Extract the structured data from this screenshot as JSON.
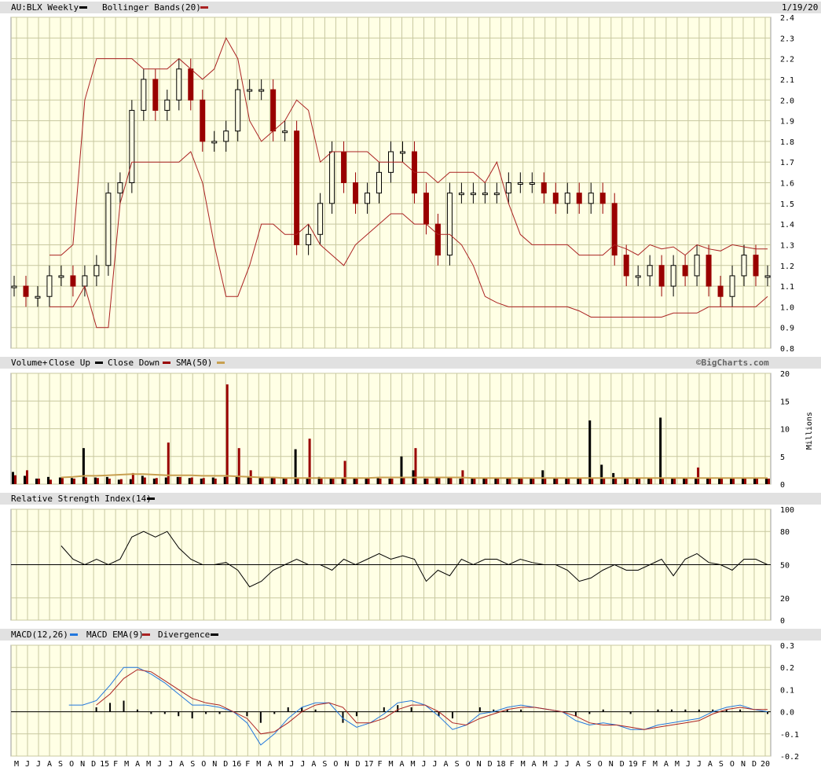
{
  "price_header": {
    "symbol_label": "AU:BLX Weekly",
    "bb_label": "Bollinger Bands(20)",
    "date": "1/19/20"
  },
  "volume_header": {
    "label": "Volume+",
    "close_up": "Close Up",
    "close_down": "Close Down",
    "sma": "SMA(50)",
    "credit": "©BigCharts.com"
  },
  "rsi_header": {
    "label": "Relative Strength Index(14)"
  },
  "macd_header": {
    "label": "MACD(12,26)",
    "ema": "MACD EMA(9)",
    "divergence": "Divergence"
  },
  "colors": {
    "panel_bg": "#ffffe5",
    "grid": "#c8c8a0",
    "up": "#000000",
    "down": "#990000",
    "band": "#aa2222",
    "sma": "#c8a050",
    "macd": "#2277dd",
    "macd_ema": "#aa2222"
  },
  "x_axis_labels": [
    "M",
    "J",
    "J",
    "A",
    "S",
    "O",
    "N",
    "D",
    "15",
    "F",
    "M",
    "A",
    "M",
    "J",
    "J",
    "A",
    "S",
    "O",
    "N",
    "D",
    "16",
    "F",
    "M",
    "A",
    "M",
    "J",
    "J",
    "A",
    "S",
    "O",
    "N",
    "D",
    "17",
    "F",
    "M",
    "A",
    "M",
    "J",
    "J",
    "A",
    "S",
    "O",
    "N",
    "D",
    "18",
    "F",
    "M",
    "A",
    "M",
    "J",
    "J",
    "A",
    "S",
    "O",
    "N",
    "D",
    "19",
    "F",
    "M",
    "A",
    "M",
    "J",
    "J",
    "A",
    "S",
    "O",
    "N",
    "D",
    "20"
  ],
  "chart_data": [
    {
      "type": "candlestick",
      "title": "AU:BLX Weekly",
      "ylim": [
        0.8,
        2.4
      ],
      "yticks": [
        0.8,
        0.9,
        1.0,
        1.1,
        1.2,
        1.3,
        1.4,
        1.5,
        1.6,
        1.7,
        1.8,
        1.9,
        2.0,
        2.1,
        2.2,
        2.3,
        2.4
      ],
      "x_range": [
        "2014-05",
        "2020-01"
      ],
      "close": [
        1.1,
        1.05,
        1.05,
        1.15,
        1.15,
        1.1,
        1.15,
        1.2,
        1.55,
        1.6,
        1.95,
        2.1,
        1.95,
        2.0,
        2.15,
        2.0,
        1.8,
        1.8,
        1.85,
        2.05,
        2.05,
        2.05,
        1.85,
        1.85,
        1.3,
        1.35,
        1.5,
        1.75,
        1.6,
        1.5,
        1.55,
        1.65,
        1.75,
        1.75,
        1.55,
        1.4,
        1.25,
        1.55,
        1.55,
        1.55,
        1.55,
        1.55,
        1.6,
        1.6,
        1.6,
        1.55,
        1.5,
        1.55,
        1.5,
        1.55,
        1.5,
        1.25,
        1.15,
        1.15,
        1.2,
        1.1,
        1.2,
        1.15,
        1.25,
        1.1,
        1.05,
        1.15,
        1.25,
        1.15,
        1.15
      ],
      "upper_band": [
        null,
        null,
        null,
        1.25,
        1.25,
        1.3,
        2.0,
        2.2,
        2.2,
        2.2,
        2.2,
        2.15,
        2.15,
        2.15,
        2.2,
        2.15,
        2.1,
        2.15,
        2.3,
        2.2,
        1.9,
        1.8,
        1.85,
        1.9,
        2.0,
        1.95,
        1.7,
        1.75,
        1.75,
        1.75,
        1.75,
        1.7,
        1.7,
        1.7,
        1.65,
        1.65,
        1.6,
        1.65,
        1.65,
        1.65,
        1.6,
        1.7,
        1.5,
        1.35,
        1.3,
        1.3,
        1.3,
        1.3,
        1.25,
        1.25,
        1.25,
        1.3,
        1.28,
        1.25,
        1.3,
        1.28,
        1.29,
        1.25,
        1.3,
        1.28,
        1.27,
        1.3,
        1.29,
        1.28,
        1.28
      ],
      "lower_band": [
        null,
        null,
        null,
        1.0,
        1.0,
        1.0,
        1.1,
        0.9,
        0.9,
        1.5,
        1.7,
        1.7,
        1.7,
        1.7,
        1.7,
        1.75,
        1.6,
        1.3,
        1.05,
        1.05,
        1.2,
        1.4,
        1.4,
        1.35,
        1.35,
        1.4,
        1.3,
        1.25,
        1.2,
        1.3,
        1.35,
        1.4,
        1.45,
        1.45,
        1.4,
        1.4,
        1.35,
        1.35,
        1.3,
        1.2,
        1.05,
        1.02,
        1.0,
        1.0,
        1.0,
        1.0,
        1.0,
        1.0,
        0.98,
        0.95,
        0.95,
        0.95,
        0.95,
        0.95,
        0.95,
        0.95,
        0.97,
        0.97,
        0.97,
        1.0,
        1.0,
        1.0,
        1.0,
        1.0,
        1.05
      ]
    },
    {
      "type": "bar",
      "title": "Volume+",
      "ylabel": "Millions",
      "ylim": [
        0,
        20
      ],
      "yticks": [
        0,
        5,
        10,
        15,
        20
      ],
      "series": [
        {
          "name": "Close Up",
          "values": [
            2.2,
            1.5,
            1.0,
            1.3,
            1.2,
            1.1,
            6.5,
            1.2,
            1.3,
            0.8,
            0.9,
            1.5,
            1.0,
            1.2,
            1.3,
            1.1,
            1.0,
            1.2,
            1.3,
            1.4,
            1.2,
            1.1,
            1.1,
            1.2,
            6.3,
            1.2,
            1.3,
            1.0,
            1.1,
            1.0,
            1.2,
            1.1,
            1.0,
            5.0,
            2.5,
            1.0,
            1.1,
            1.2,
            1.0,
            1.1,
            1.0,
            1.2,
            1.1,
            1.0,
            1.0,
            2.5,
            1.0,
            1.1,
            1.0,
            11.5,
            3.5,
            2.0,
            1.0,
            1.0,
            1.1,
            12.0,
            1.0,
            1.0,
            1.2,
            1.1,
            1.0,
            1.1,
            1.0,
            1.2,
            1.1
          ]
        },
        {
          "name": "Close Down",
          "values": [
            1.6,
            2.5,
            1.0,
            0.8,
            1.1,
            1.0,
            1.2,
            1.1,
            1.0,
            0.9,
            2.0,
            1.2,
            1.1,
            7.5,
            1.3,
            1.2,
            1.1,
            1.0,
            18.0,
            6.5,
            2.5,
            1.2,
            1.2,
            1.1,
            1.0,
            8.2,
            1.0,
            1.1,
            4.2,
            1.1,
            1.0,
            1.0,
            1.0,
            1.2,
            6.5,
            1.0,
            1.1,
            1.1,
            2.5,
            1.0,
            1.0,
            1.2,
            1.1,
            1.0,
            1.0,
            1.0,
            1.1,
            1.0,
            1.0,
            1.0,
            1.1,
            1.0,
            1.0,
            1.0,
            1.0,
            1.2,
            1.0,
            1.0,
            3.0,
            1.0,
            1.0,
            1.0,
            1.0,
            1.0,
            1.0
          ]
        },
        {
          "name": "SMA(50)",
          "values": [
            null,
            null,
            null,
            null,
            1.2,
            1.3,
            1.5,
            1.5,
            1.6,
            1.7,
            1.8,
            1.8,
            1.7,
            1.6,
            1.6,
            1.6,
            1.5,
            1.5,
            1.5,
            1.4,
            1.3,
            1.2,
            1.2,
            1.1,
            1.1,
            1.1,
            1.1,
            1.1,
            1.1,
            1.1,
            1.1,
            1.2,
            1.2,
            1.2,
            1.2,
            1.2,
            1.2,
            1.2,
            1.2,
            1.1,
            1.1,
            1.1,
            1.1,
            1.1,
            1.1,
            1.1,
            1.1,
            1.1,
            1.1,
            1.1,
            1.1,
            1.1,
            1.1,
            1.1,
            1.1,
            1.1,
            1.1,
            1.1,
            1.1,
            1.1,
            1.1,
            1.1,
            1.1,
            1.1,
            1.1
          ]
        }
      ]
    },
    {
      "type": "line",
      "title": "Relative Strength Index(14)",
      "ylim": [
        0,
        100
      ],
      "yticks": [
        0,
        20,
        50,
        80,
        100
      ],
      "reference_line": 50,
      "values": [
        null,
        null,
        null,
        null,
        67,
        55,
        50,
        55,
        50,
        55,
        75,
        80,
        75,
        80,
        65,
        55,
        50,
        50,
        52,
        45,
        30,
        35,
        45,
        50,
        55,
        50,
        50,
        45,
        55,
        50,
        55,
        60,
        55,
        58,
        55,
        35,
        45,
        40,
        55,
        50,
        55,
        55,
        50,
        55,
        52,
        50,
        50,
        45,
        35,
        38,
        45,
        50,
        45,
        45,
        50,
        55,
        40,
        55,
        60,
        52,
        50,
        45,
        55,
        55,
        50
      ]
    },
    {
      "type": "line",
      "title": "MACD(12,26)",
      "ylim": [
        -0.2,
        0.3
      ],
      "yticks": [
        -0.2,
        -0.1,
        0.0,
        0.1,
        0.2,
        0.3
      ],
      "reference_line": 0,
      "series": [
        {
          "name": "MACD(12,26)",
          "values": [
            null,
            null,
            null,
            null,
            0.03,
            0.03,
            0.05,
            0.12,
            0.2,
            0.2,
            0.17,
            0.13,
            0.08,
            0.03,
            0.03,
            0.02,
            0.0,
            -0.05,
            -0.15,
            -0.1,
            -0.03,
            0.02,
            0.04,
            0.04,
            -0.03,
            -0.07,
            -0.05,
            -0.01,
            0.04,
            0.05,
            0.03,
            -0.02,
            -0.08,
            -0.06,
            -0.01,
            0.0,
            0.02,
            0.03,
            0.02,
            0.01,
            0.0,
            -0.04,
            -0.06,
            -0.05,
            -0.06,
            -0.08,
            -0.08,
            -0.06,
            -0.05,
            -0.04,
            -0.03,
            0.0,
            0.02,
            0.03,
            0.01,
            0.0
          ]
        },
        {
          "name": "MACD EMA(9)",
          "values": [
            null,
            null,
            null,
            null,
            null,
            null,
            0.03,
            0.08,
            0.15,
            0.19,
            0.18,
            0.14,
            0.1,
            0.06,
            0.04,
            0.03,
            0.0,
            -0.03,
            -0.1,
            -0.09,
            -0.05,
            0.0,
            0.03,
            0.04,
            0.02,
            -0.05,
            -0.05,
            -0.03,
            0.01,
            0.03,
            0.03,
            0.0,
            -0.05,
            -0.06,
            -0.03,
            -0.01,
            0.01,
            0.02,
            0.02,
            0.01,
            0.0,
            -0.02,
            -0.05,
            -0.06,
            -0.06,
            -0.07,
            -0.08,
            -0.07,
            -0.06,
            -0.05,
            -0.04,
            -0.01,
            0.01,
            0.02,
            0.01,
            0.01
          ]
        },
        {
          "name": "Divergence",
          "values": [
            null,
            null,
            null,
            null,
            null,
            null,
            0.02,
            0.04,
            0.05,
            0.01,
            -0.01,
            -0.01,
            -0.02,
            -0.03,
            -0.01,
            -0.01,
            0.0,
            -0.02,
            -0.05,
            -0.01,
            0.02,
            0.02,
            0.01,
            0.0,
            -0.05,
            -0.02,
            0.0,
            0.02,
            0.03,
            0.02,
            0.0,
            -0.02,
            -0.03,
            0.0,
            0.02,
            0.01,
            0.01,
            0.01,
            0.0,
            0.0,
            0.0,
            -0.02,
            -0.01,
            0.01,
            0.0,
            -0.01,
            0.0,
            0.01,
            0.01,
            0.01,
            0.01,
            0.01,
            0.01,
            0.01,
            0.0,
            -0.01
          ]
        }
      ]
    }
  ]
}
